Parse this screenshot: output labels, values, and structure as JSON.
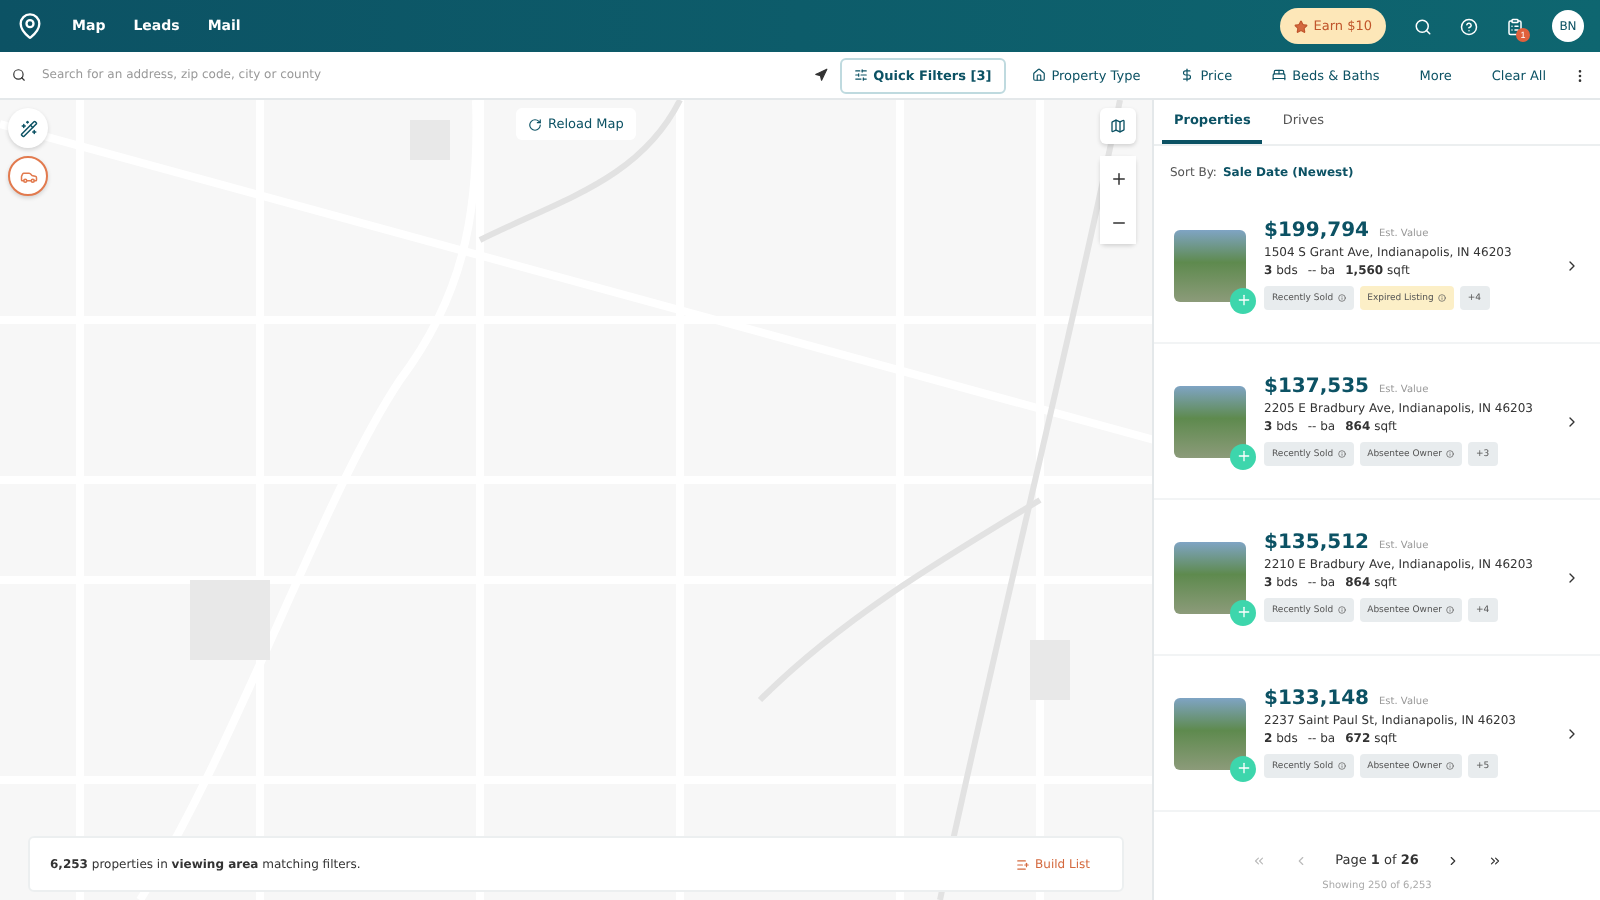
{
  "nav": {
    "links": [
      "Map",
      "Leads",
      "Mail"
    ],
    "earn": "Earn $10",
    "badge": "1",
    "avatar": "BN"
  },
  "search": {
    "placeholder": "Search for an address, zip code, city or county"
  },
  "filters": [
    {
      "label": "Quick Filters [3]",
      "selected": true,
      "kind": "quick"
    },
    {
      "label": "Property Type",
      "selected": false,
      "kind": "type"
    },
    {
      "label": "Price",
      "selected": false,
      "kind": "price"
    },
    {
      "label": "Beds & Baths",
      "selected": false,
      "kind": "beds"
    },
    {
      "label": "More",
      "selected": false,
      "kind": "plain"
    },
    {
      "label": "Clear All",
      "selected": false,
      "kind": "plain"
    }
  ],
  "map": {
    "reload": "Reload Map",
    "summary": "**6,253** properties in **viewing area** matching filters.",
    "build": "Build List"
  },
  "panel": {
    "tabs": [
      {
        "label": "Properties",
        "selected": true
      },
      {
        "label": "Drives",
        "selected": false
      }
    ],
    "sort_label": "Sort By:",
    "sort_value": "Sale Date (Newest)"
  },
  "properties": [
    {
      "price": "$199,794",
      "est": "Est. Value",
      "address": "1504 S Grant Ave, Indianapolis, IN 46203",
      "beds": "3",
      "beds_unit": "bds",
      "baths": "--",
      "baths_unit": "ba",
      "sqft": "1,560",
      "sqft_unit": "sqft",
      "tags": [
        {
          "label": "Recently Sold",
          "kind": "default"
        },
        {
          "label": "Expired Listing",
          "kind": "warning"
        }
      ],
      "more": "+4"
    },
    {
      "price": "$137,535",
      "est": "Est. Value",
      "address": "2205 E Bradbury Ave, Indianapolis, IN 46203",
      "beds": "3",
      "beds_unit": "bds",
      "baths": "--",
      "baths_unit": "ba",
      "sqft": "864",
      "sqft_unit": "sqft",
      "tags": [
        {
          "label": "Recently Sold",
          "kind": "default"
        },
        {
          "label": "Absentee Owner",
          "kind": "default"
        }
      ],
      "more": "+3"
    },
    {
      "price": "$135,512",
      "est": "Est. Value",
      "address": "2210 E Bradbury Ave, Indianapolis, IN 46203",
      "beds": "3",
      "beds_unit": "bds",
      "baths": "--",
      "baths_unit": "ba",
      "sqft": "864",
      "sqft_unit": "sqft",
      "tags": [
        {
          "label": "Recently Sold",
          "kind": "default"
        },
        {
          "label": "Absentee Owner",
          "kind": "default"
        }
      ],
      "more": "+4"
    },
    {
      "price": "$133,148",
      "est": "Est. Value",
      "address": "2237 Saint Paul St, Indianapolis, IN 46203",
      "beds": "2",
      "beds_unit": "bds",
      "baths": "--",
      "baths_unit": "ba",
      "sqft": "672",
      "sqft_unit": "sqft",
      "tags": [
        {
          "label": "Recently Sold",
          "kind": "default"
        },
        {
          "label": "Absentee Owner",
          "kind": "default"
        }
      ],
      "more": "+5"
    }
  ],
  "pagination": {
    "page_label": "Page",
    "page": "1",
    "of": "of",
    "total": "26",
    "showing": "Showing 250 of 6,253"
  }
}
